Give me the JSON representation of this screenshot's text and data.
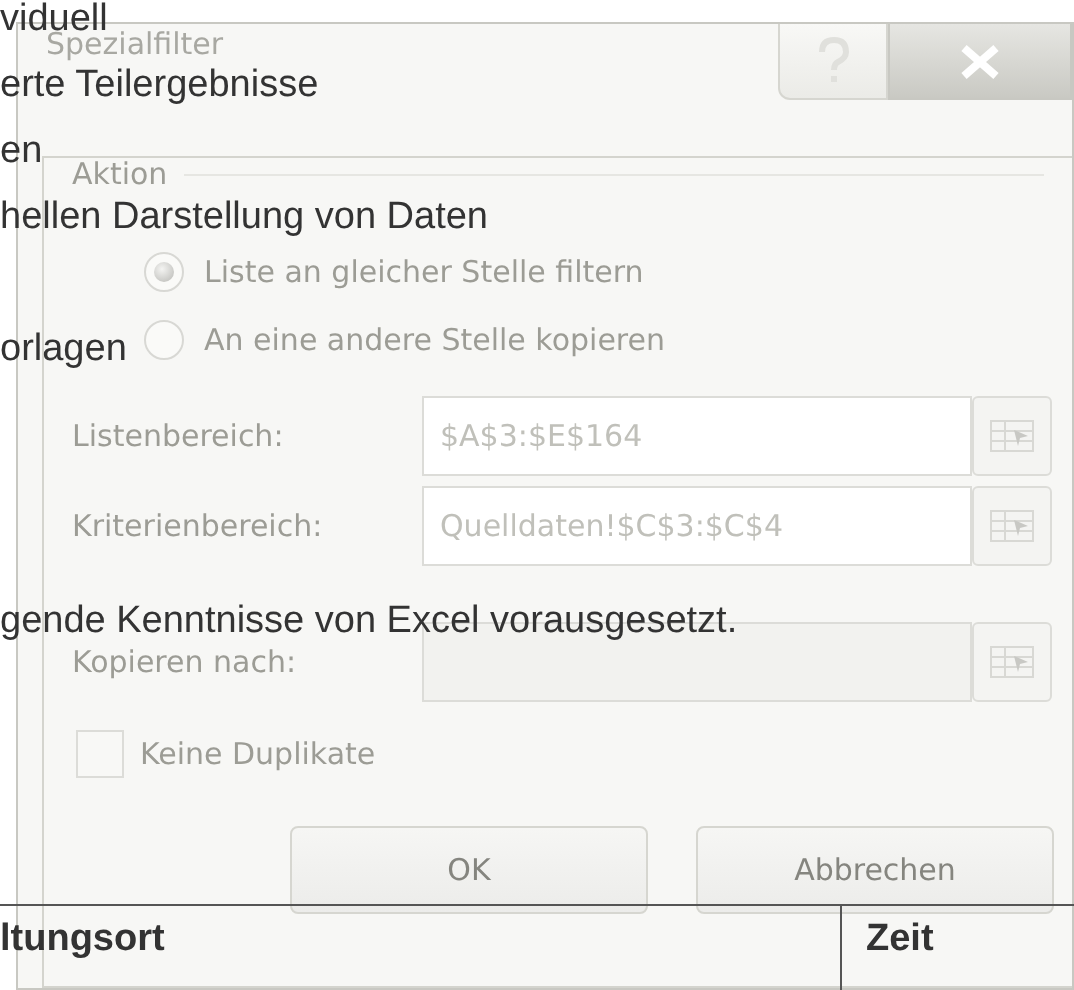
{
  "document": {
    "lines": [
      {
        "text": "viduell"
      },
      {
        "text": "erte Teilergebnisse"
      },
      {
        "text": "en"
      },
      {
        "text": "hellen Darstellung von Daten"
      },
      {
        "text": "orlagen"
      },
      {
        "text": "gende Kenntnisse von Excel vorausgesetzt."
      }
    ],
    "table_header": [
      "ltungsort",
      "Zeit"
    ]
  },
  "dialog": {
    "title": "Spezialfilter",
    "group": "Aktion",
    "options": [
      {
        "label": "Liste an gleicher Stelle filtern",
        "selected": true
      },
      {
        "label": "An eine andere Stelle kopieren",
        "selected": false
      }
    ],
    "fields": [
      {
        "label": "Listenbereich:",
        "value": "$A$3:$E$164",
        "disabled": false
      },
      {
        "label": "Kriterienbereich:",
        "value": "Quelldaten!$C$3:$C$4",
        "disabled": false
      },
      {
        "label": "Kopieren nach:",
        "disabled": true
      }
    ],
    "checkbox": {
      "label": "Keine Duplikate",
      "checked": false
    },
    "buttons": [
      "OK",
      "Abbrechen"
    ]
  }
}
